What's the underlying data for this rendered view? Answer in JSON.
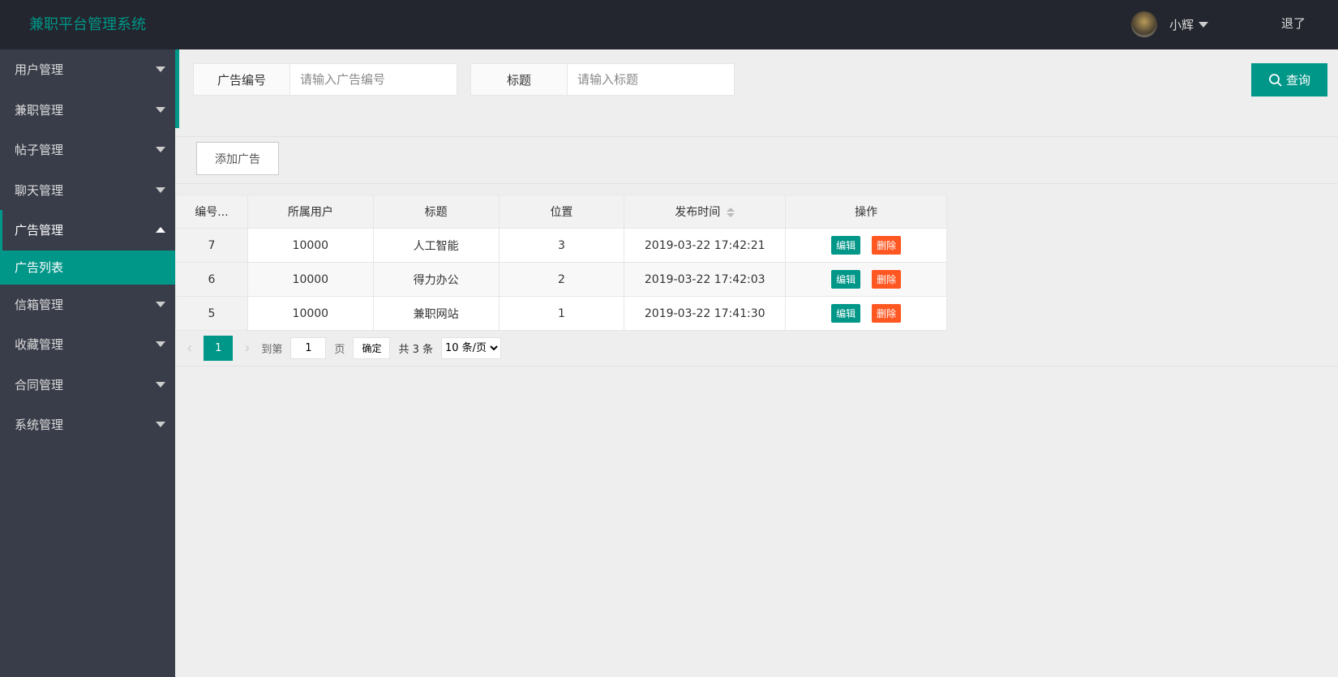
{
  "header": {
    "title": "兼职平台管理系统",
    "username": "小辉",
    "logout": "退了"
  },
  "sidebar": {
    "items": [
      {
        "label": "用户管理"
      },
      {
        "label": "兼职管理"
      },
      {
        "label": "帖子管理"
      },
      {
        "label": "聊天管理"
      },
      {
        "label": "广告管理"
      },
      {
        "label": "信箱管理"
      },
      {
        "label": "收藏管理"
      },
      {
        "label": "合同管理"
      },
      {
        "label": "系统管理"
      }
    ],
    "sub": "广告列表"
  },
  "search": {
    "id_label": "广告编号",
    "id_placeholder": "请输入广告编号",
    "title_label": "标题",
    "title_placeholder": "请输入标题",
    "query": "查询"
  },
  "toolbar": {
    "add": "添加广告"
  },
  "table": {
    "headers": [
      "编号...",
      "所属用户",
      "标题",
      "位置",
      "发布时间",
      "操作"
    ],
    "rows": [
      [
        "7",
        "10000",
        "人工智能",
        "3",
        "2019-03-22 17:42:21"
      ],
      [
        "6",
        "10000",
        "得力办公",
        "2",
        "2019-03-22 17:42:03"
      ],
      [
        "5",
        "10000",
        "兼职网站",
        "1",
        "2019-03-22 17:41:30"
      ]
    ],
    "edit": "编辑",
    "delete": "删除"
  },
  "pager": {
    "current": "1",
    "goto": "到第",
    "page_value": "1",
    "page_unit": "页",
    "confirm": "确定",
    "total": "共 3 条",
    "page_size": "10 条/页"
  }
}
